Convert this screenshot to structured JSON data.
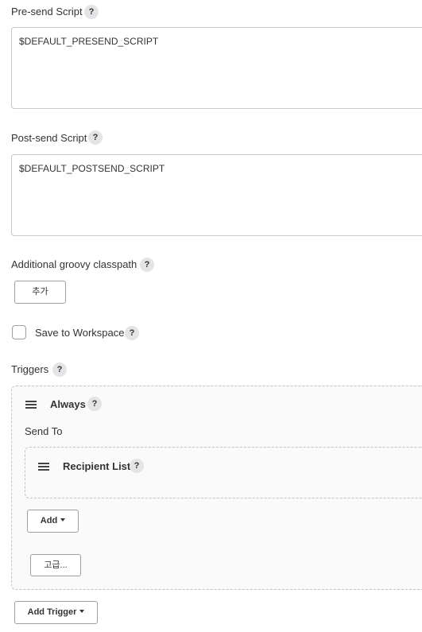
{
  "presend": {
    "label": "Pre-send Script",
    "value": "$DEFAULT_PRESEND_SCRIPT"
  },
  "postsend": {
    "label": "Post-send Script",
    "value": "$DEFAULT_POSTSEND_SCRIPT"
  },
  "classpath": {
    "label": "Additional groovy classpath",
    "add_label": "추가"
  },
  "workspace": {
    "label": "Save to Workspace"
  },
  "triggers": {
    "label": "Triggers",
    "trigger": {
      "title": "Always",
      "send_to_label": "Send To",
      "recipient": {
        "title": "Recipient List"
      },
      "add_label": "Add",
      "advanced_label": "고급..."
    },
    "add_trigger_label": "Add Trigger"
  },
  "help_glyph": "?",
  "icons": {
    "help": "question-circle-icon",
    "drag": "drag-handle-icon",
    "caret": "caret-down-icon"
  },
  "colors": {
    "help_bg": "#e4e4e6",
    "border": "#c9c9cd",
    "dashed_border": "#c3c3c3"
  }
}
